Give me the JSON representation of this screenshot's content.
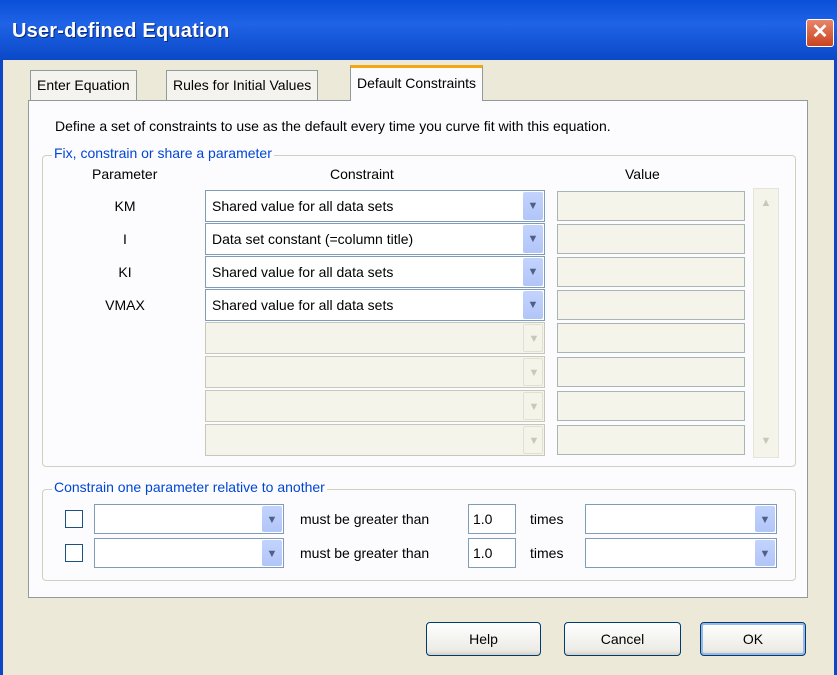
{
  "window": {
    "title": "User-defined Equation",
    "close_glyph": "✕"
  },
  "tabs": [
    {
      "label": "Enter Equation"
    },
    {
      "label": "Rules for Initial Values"
    },
    {
      "label": "Default Constraints"
    }
  ],
  "description": "Define a set of constraints to use as the default every time you curve fit with this equation.",
  "fix_group": {
    "legend": "Fix, constrain or share a parameter",
    "headers": {
      "parameter": "Parameter",
      "constraint": "Constraint",
      "value": "Value"
    },
    "rows": [
      {
        "parameter": "KM",
        "constraint": "Shared value for all data sets",
        "value": ""
      },
      {
        "parameter": "I",
        "constraint": "Data set constant (=column title)",
        "value": ""
      },
      {
        "parameter": "KI",
        "constraint": "Shared value for all data sets",
        "value": ""
      },
      {
        "parameter": "VMAX",
        "constraint": "Shared value for all data sets",
        "value": ""
      },
      {
        "parameter": "",
        "constraint": "",
        "value": ""
      },
      {
        "parameter": "",
        "constraint": "",
        "value": ""
      },
      {
        "parameter": "",
        "constraint": "",
        "value": ""
      },
      {
        "parameter": "",
        "constraint": "",
        "value": ""
      }
    ]
  },
  "relative_group": {
    "legend": "Constrain one parameter relative to another",
    "rows": [
      {
        "checked": false,
        "param_a": "",
        "relation": "must be greater than",
        "factor": "1.0",
        "times": "times",
        "param_b": ""
      },
      {
        "checked": false,
        "param_a": "",
        "relation": "must be greater than",
        "factor": "1.0",
        "times": "times",
        "param_b": ""
      }
    ]
  },
  "buttons": {
    "help": "Help",
    "cancel": "Cancel",
    "ok": "OK"
  },
  "icons": {
    "dropdown": "chevron-down-icon",
    "scroll_up": "scroll-up-arrow-icon",
    "scroll_down": "scroll-down-arrow-icon",
    "close": "close-icon"
  },
  "colors": {
    "titlebar": "#0a4fd8",
    "legend_text": "#0046d5",
    "active_tab_highlight": "#f1a90f",
    "close_button": "#c9431f"
  }
}
